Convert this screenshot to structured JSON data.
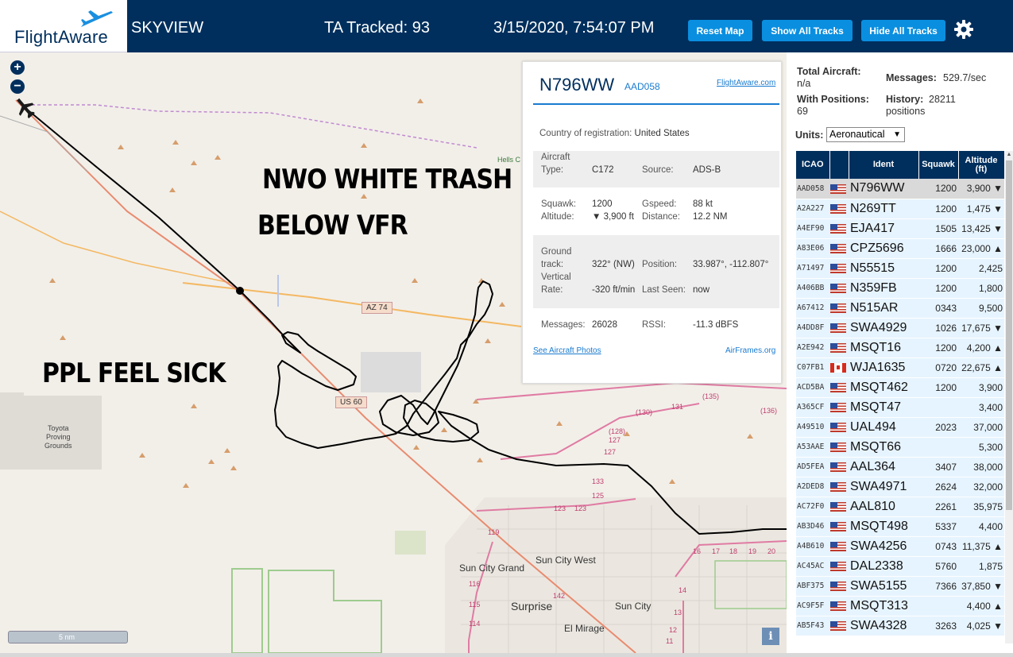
{
  "header": {
    "logo_text": "FlightAware",
    "app_name": "SKYVIEW",
    "tracked": "TA Tracked: 93",
    "datetime": "3/15/2020, 7:54:07 PM",
    "buttons": {
      "reset": "Reset Map",
      "show_tracks": "Show All Tracks",
      "hide_tracks": "Hide All Tracks"
    },
    "settings_icon": "gear-icon",
    "colors": {
      "bar": "#002f5d",
      "button": "#0a8fe0"
    }
  },
  "map": {
    "annotations": {
      "nwo": "NWO WHITE TRASH",
      "vfr": "BELOW VFR",
      "ppl": "PPL FEEL SICK"
    },
    "places": {
      "sun_city_grand": "Sun City Grand",
      "sun_city_west": "Sun City West",
      "sun_city": "Sun City",
      "surprise": "Surprise",
      "el_mirage": "El Mirage",
      "toyota_1": "Toyota",
      "toyota_2": "Proving",
      "toyota_3": "Grounds",
      "hells": "Hells C"
    },
    "roads": {
      "az74": "AZ 74",
      "us60": "US 60"
    },
    "exit_numbers": {
      "e135": "(135)",
      "e130": "(130)",
      "e131": "131",
      "e136": "(136)",
      "e128": "(128)",
      "e127a": "127",
      "e127b": "127",
      "e125": "125",
      "e133": "133",
      "e123a": "123",
      "e123b": "123",
      "e119": "119",
      "e116": "116",
      "e115": "115",
      "e114": "114",
      "e142": "142",
      "e16": "16",
      "e17": "17",
      "e18": "18",
      "e19": "19",
      "e20": "20",
      "e14": "14",
      "e13": "13",
      "e12": "12",
      "e11": "11"
    },
    "scale": "5 nm",
    "info": "i",
    "zoom_in": "+",
    "zoom_out": "−"
  },
  "popup": {
    "ident": "N796WW",
    "icao": "AAD058",
    "fa_link": "FlightAware.com",
    "country_label": "Country of registration:",
    "country": "United States",
    "aircraft_type_label_1": "Aircraft",
    "aircraft_type_label_2": "Type:",
    "aircraft_type": "C172",
    "source_label": "Source:",
    "source": "ADS-B",
    "squawk_label": "Squawk:",
    "squawk": "1200",
    "gspeed_label": "Gspeed:",
    "gspeed": "88 kt",
    "altitude_label": "Altitude:",
    "altitude": "▼ 3,900 ft",
    "distance_label": "Distance:",
    "distance": "12.2 NM",
    "track_label_1": "Ground",
    "track_label_2": "track:",
    "track": "322° (NW)",
    "position_label": "Position:",
    "position": "33.987°, -112.807°",
    "vrate_label_1": "Vertical",
    "vrate_label_2": "Rate:",
    "vrate": "-320 ft/min",
    "last_seen_label": "Last Seen:",
    "last_seen": "now",
    "messages_label": "Messages:",
    "messages": "26028",
    "rssi_label": "RSSI:",
    "rssi": "-11.3 dBFS",
    "photos_link": "See Aircraft Photos",
    "airframes_link": "AirFrames.org"
  },
  "panel": {
    "total_label": "Total Aircraft:",
    "total_value": "n/a",
    "messages_label": "Messages:",
    "messages_value": "529.7/sec",
    "positions_label": "With Positions:",
    "positions_value": "69",
    "history_label": "History:",
    "history_value_1": "28211",
    "history_value_2": "positions",
    "units_label": "Units:",
    "units_value": "Aeronautical",
    "columns": {
      "icao": "ICAO",
      "ident": "Ident",
      "squawk": "Squawk",
      "altitude_1": "Altitude",
      "altitude_2": "(ft)"
    },
    "rows": [
      {
        "icao": "AAD058",
        "flag": "us",
        "ident": "N796WW",
        "squawk": "1200",
        "altitude": "3,900 ▼",
        "selected": true
      },
      {
        "icao": "A2A227",
        "flag": "us",
        "ident": "N269TT",
        "squawk": "1200",
        "altitude": "1,475 ▼"
      },
      {
        "icao": "A4EF90",
        "flag": "us",
        "ident": "EJA417",
        "squawk": "1505",
        "altitude": "13,425 ▼"
      },
      {
        "icao": "A83E06",
        "flag": "us",
        "ident": "CPZ5696",
        "squawk": "1666",
        "altitude": "23,000 ▲"
      },
      {
        "icao": "A71497",
        "flag": "us",
        "ident": "N55515",
        "squawk": "1200",
        "altitude": "2,425"
      },
      {
        "icao": "A406BB",
        "flag": "us",
        "ident": "N359FB",
        "squawk": "1200",
        "altitude": "1,800"
      },
      {
        "icao": "A67412",
        "flag": "us",
        "ident": "N515AR",
        "squawk": "0343",
        "altitude": "9,500"
      },
      {
        "icao": "A4DD8F",
        "flag": "us",
        "ident": "SWA4929",
        "squawk": "1026",
        "altitude": "17,675 ▼"
      },
      {
        "icao": "A2E942",
        "flag": "us",
        "ident": "MSQT16",
        "squawk": "1200",
        "altitude": "4,200 ▲"
      },
      {
        "icao": "C07FB1",
        "flag": "ca",
        "ident": "WJA1635",
        "squawk": "0720",
        "altitude": "22,675 ▲"
      },
      {
        "icao": "ACD5BA",
        "flag": "us",
        "ident": "MSQT462",
        "squawk": "1200",
        "altitude": "3,900"
      },
      {
        "icao": "A365CF",
        "flag": "us",
        "ident": "MSQT47",
        "squawk": "",
        "altitude": "3,400"
      },
      {
        "icao": "A49510",
        "flag": "us",
        "ident": "UAL494",
        "squawk": "2023",
        "altitude": "37,000"
      },
      {
        "icao": "A53AAE",
        "flag": "us",
        "ident": "MSQT66",
        "squawk": "",
        "altitude": "5,300"
      },
      {
        "icao": "AD5FEA",
        "flag": "us",
        "ident": "AAL364",
        "squawk": "3407",
        "altitude": "38,000"
      },
      {
        "icao": "A2DED8",
        "flag": "us",
        "ident": "SWA4971",
        "squawk": "2624",
        "altitude": "32,000"
      },
      {
        "icao": "AC72F0",
        "flag": "us",
        "ident": "AAL810",
        "squawk": "2261",
        "altitude": "35,975"
      },
      {
        "icao": "AB3D46",
        "flag": "us",
        "ident": "MSQT498",
        "squawk": "5337",
        "altitude": "4,400"
      },
      {
        "icao": "A4B610",
        "flag": "us",
        "ident": "SWA4256",
        "squawk": "0743",
        "altitude": "11,375 ▲"
      },
      {
        "icao": "AC45AC",
        "flag": "us",
        "ident": "DAL2338",
        "squawk": "5760",
        "altitude": "1,875"
      },
      {
        "icao": "ABF375",
        "flag": "us",
        "ident": "SWA5155",
        "squawk": "7366",
        "altitude": "37,850 ▼"
      },
      {
        "icao": "AC9F5F",
        "flag": "us",
        "ident": "MSQT313",
        "squawk": "",
        "altitude": "4,400 ▲"
      },
      {
        "icao": "AB5F43",
        "flag": "us",
        "ident": "SWA4328",
        "squawk": "3263",
        "altitude": "4,025 ▼"
      }
    ]
  }
}
